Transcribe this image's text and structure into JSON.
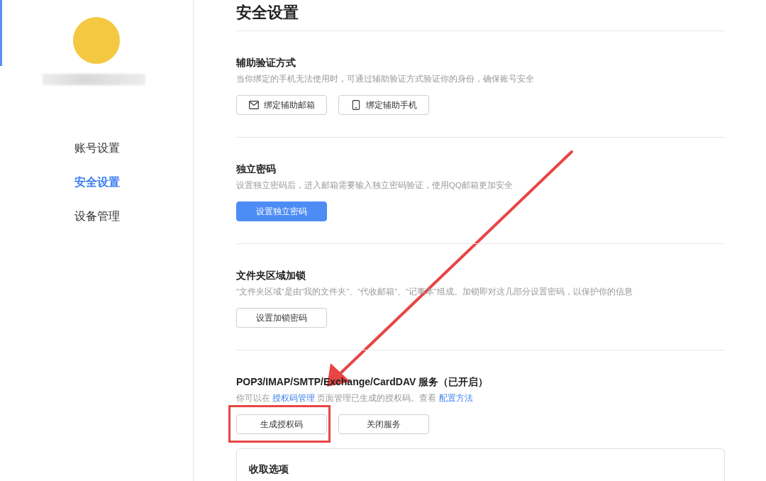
{
  "sidebar": {
    "items": [
      {
        "label": "账号设置",
        "selected": false
      },
      {
        "label": "安全设置",
        "selected": true
      },
      {
        "label": "设备管理",
        "selected": false
      }
    ]
  },
  "title": "安全设置",
  "sections": [
    {
      "heading": "辅助验证方式",
      "description": [
        {
          "text": "当你绑定的手机无法使用时，可通过辅助验证方式验证你的身份，确保账号安全",
          "link": false
        }
      ],
      "buttons": [
        {
          "label": "绑定辅助邮箱",
          "kind": "mail",
          "highlighted": false
        },
        {
          "label": "绑定辅助手机",
          "kind": "phone",
          "highlighted": false
        }
      ]
    },
    {
      "heading": "独立密码",
      "description": [
        {
          "text": "设置独立密码后，进入邮箱需要输入独立密码验证，使用QQ邮箱更加安全",
          "link": false
        }
      ],
      "buttons": [
        {
          "label": "设置独立密码",
          "kind": "primary",
          "highlighted": false
        }
      ]
    },
    {
      "heading": "文件夹区域加锁",
      "description": [
        {
          "text": "“文件夹区域”是由“我的文件夹”、“代收邮箱”、“记事本”组成。加锁即对这几部分设置密码，以保护你的信息",
          "link": false
        }
      ],
      "buttons": [
        {
          "label": "设置加锁密码",
          "kind": "plain",
          "highlighted": false
        }
      ]
    },
    {
      "heading": "POP3/IMAP/SMTP/Exchange/CardDAV 服务（已开启）",
      "description": [
        {
          "text": "你可以在 ",
          "link": false
        },
        {
          "text": "授权码管理",
          "link": true
        },
        {
          "text": " 页面管理已生成的授权码。查看 ",
          "link": false
        },
        {
          "text": "配置方法",
          "link": true
        }
      ],
      "buttons": [
        {
          "label": "生成授权码",
          "kind": "plain",
          "highlighted": true
        },
        {
          "label": "关闭服务",
          "kind": "plain",
          "highlighted": false
        }
      ]
    }
  ],
  "options_box": {
    "heading": "收取选项"
  }
}
